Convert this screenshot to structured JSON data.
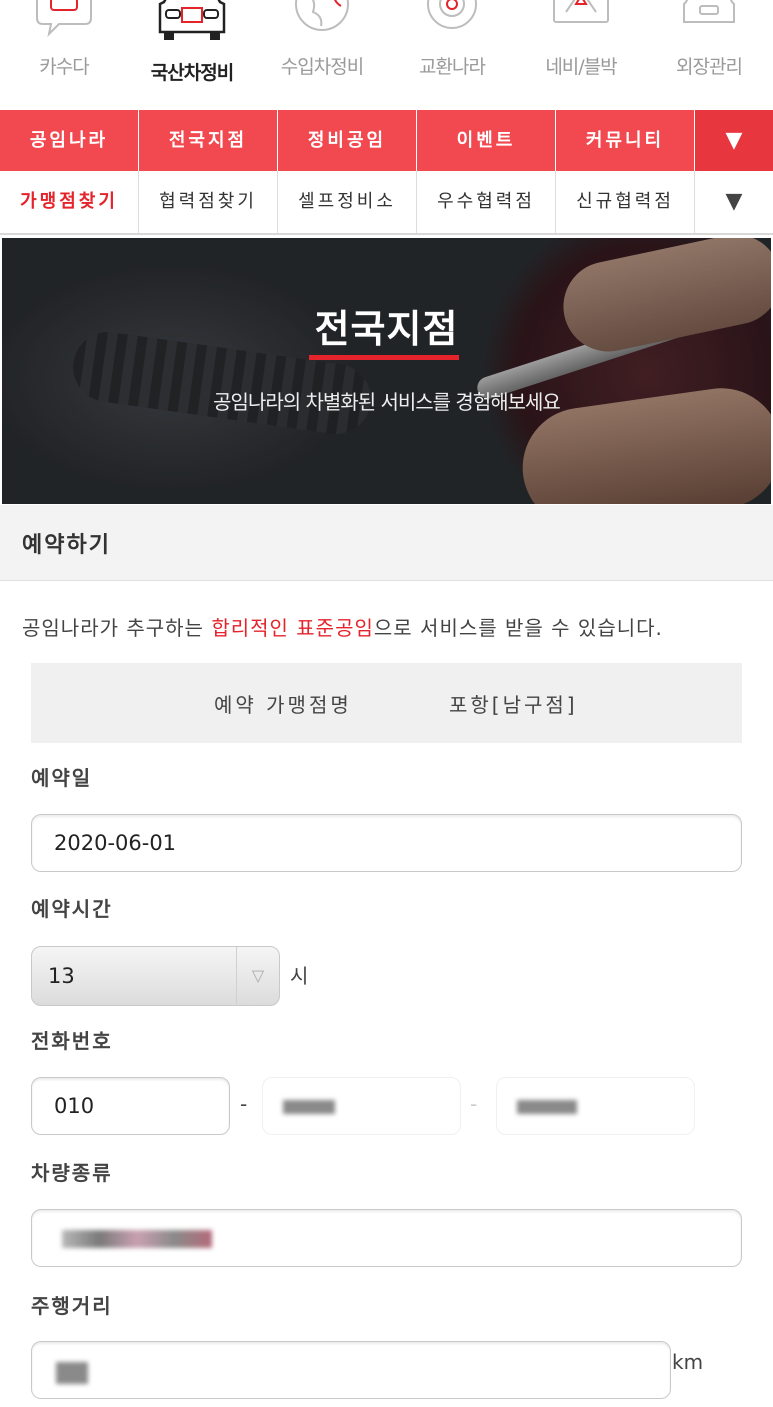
{
  "categories": [
    {
      "label": "카수다",
      "active": false
    },
    {
      "label": "국산차정비",
      "active": true
    },
    {
      "label": "수입차정비",
      "active": false
    },
    {
      "label": "교환나라",
      "active": false
    },
    {
      "label": "네비/블박",
      "active": false
    },
    {
      "label": "외장관리",
      "active": false
    }
  ],
  "main_nav": {
    "items": [
      "공임나라",
      "전국지점",
      "정비공임",
      "이벤트",
      "커뮤니티"
    ],
    "more": "▼"
  },
  "sub_nav": {
    "items": [
      "가맹점찾기",
      "협력점찾기",
      "셀프정비소",
      "우수협력점",
      "신규협력점"
    ],
    "more": "▼"
  },
  "banner": {
    "title": "전국지점",
    "subtitle": "공임나라의 차별화된 서비스를 경험해보세요"
  },
  "reservation": {
    "heading": "예약하기",
    "intro_before": "공임나라가 추구하는 ",
    "intro_highlight": "합리적인 표준공임",
    "intro_after": "으로 서비스를 받을 수 있습니다.",
    "store_label": "예약 가맹점명",
    "store_value": "포항[남구점]",
    "date_label": "예약일",
    "date_value": "2020-06-01",
    "time_label": "예약시간",
    "time_value": "13",
    "time_unit": "시",
    "phone_label": "전화번호",
    "phone_first": "010",
    "phone_sep": "-",
    "vehicle_label": "차량종류",
    "mileage_label": "주행거리",
    "mileage_unit": "km"
  },
  "colors": {
    "accent": "#f2484f",
    "highlight": "#e5232b"
  }
}
